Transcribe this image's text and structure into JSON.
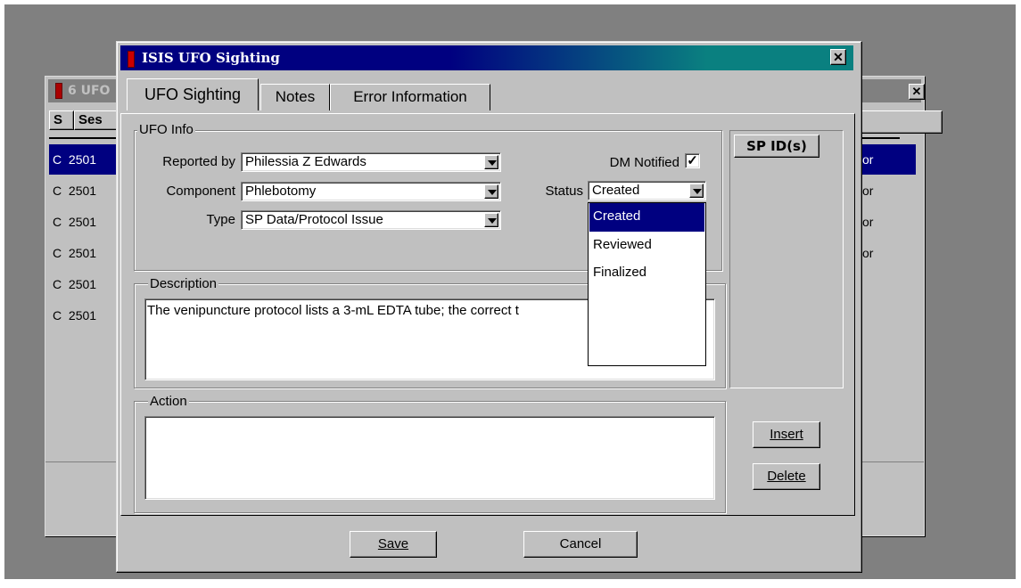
{
  "background_window": {
    "title": "6 UFO",
    "close_glyph": "✕",
    "headers": [
      "S",
      "Ses"
    ],
    "rows": [
      {
        "status": "C",
        "session": "2501",
        "right": "or"
      },
      {
        "status": "C",
        "session": "2501",
        "right": "or"
      },
      {
        "status": "C",
        "session": "2501",
        "right": "or"
      },
      {
        "status": "C",
        "session": "2501",
        "right": "or"
      },
      {
        "status": "C",
        "session": "2501",
        "right": ""
      },
      {
        "status": "C",
        "session": "2501",
        "right": ""
      }
    ]
  },
  "dialog": {
    "title": "ISIS UFO Sighting",
    "close_glyph": "✕",
    "tabs": [
      {
        "label": "UFO Sighting",
        "active": true
      },
      {
        "label": "Notes",
        "active": false
      },
      {
        "label": "Error Information",
        "active": false
      }
    ],
    "ufo_info": {
      "legend": "UFO Info",
      "reported_by_label": "Reported by",
      "reported_by_value": "Philessia Z Edwards",
      "component_label": "Component",
      "component_value": "Phlebotomy",
      "type_label": "Type",
      "type_value": "SP Data/Protocol Issue",
      "dm_notified_label": "DM Notified",
      "dm_notified_checked": true,
      "status_label": "Status",
      "status_value": "Created",
      "status_options": [
        "Created",
        "Reviewed",
        "Finalized"
      ]
    },
    "sp_ids_header": "SP ID(s)",
    "description": {
      "legend": "Description",
      "text": "The venipuncture protocol lists a 3-mL EDTA tube; the correct t"
    },
    "action": {
      "legend": "Action",
      "text": ""
    },
    "buttons": {
      "insert": "Insert",
      "delete": "Delete",
      "save": "Save",
      "cancel": "Cancel"
    }
  },
  "colors": {
    "face": "#c0c0c0",
    "desktop": "#808080",
    "selection": "#000080",
    "title_active_start": "#000080",
    "title_active_end": "#0a8080"
  }
}
